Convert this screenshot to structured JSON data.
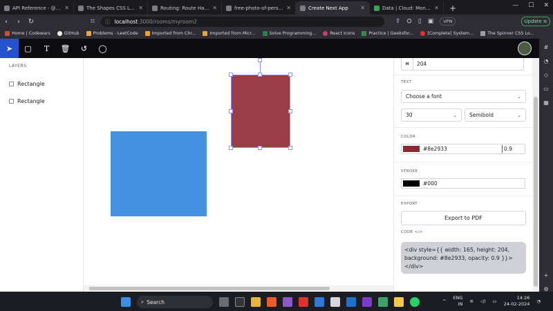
{
  "browser": {
    "tabs": [
      {
        "label": "API Reference - @liveblocks/re",
        "active": false
      },
      {
        "label": "The Shapes CSS Loaders Collec",
        "active": false
      },
      {
        "label": "Routing: Route Handlers | Next",
        "active": false
      },
      {
        "label": "free-photo-of-person-in-frenc",
        "active": false
      },
      {
        "label": "Create Next App",
        "active": true
      },
      {
        "label": "Data | Cloud: MongoDB Cloud",
        "active": false
      }
    ],
    "new_tab": "+",
    "url_host": "localhost",
    "url_path": ":3000/rooms/myroom2",
    "vpn_label": "VPN",
    "update_label": "Update",
    "bookmarks": [
      "Home | Codewars",
      "GitHub",
      "Problems - LeetCode",
      "Imported from Chr...",
      "Imported from Micr...",
      "Solve Programming...",
      "React Icons",
      "Practice | Geeksfor...",
      "[Complete] System...",
      "The Spinner CSS Lo..."
    ]
  },
  "toolbar": {
    "tools": [
      "select-tool",
      "rectangle-tool",
      "text-tool",
      "delete-tool",
      "undo-tool",
      "comment-tool"
    ],
    "active_tool": "select-tool"
  },
  "layers": {
    "title": "LAYERS",
    "items": [
      "Rectangle",
      "Rectangle"
    ]
  },
  "canvas": {
    "shapes": [
      {
        "type": "rectangle",
        "color": "#8e2933",
        "opacity": 0.9,
        "selected": true
      },
      {
        "type": "rectangle",
        "color": "#4393e0",
        "selected": false
      }
    ]
  },
  "properties": {
    "height_label": "H",
    "height_value": "204",
    "text_section": "TEXT",
    "font_family_placeholder": "Choose a font",
    "font_size": "30",
    "font_weight": "Semibold",
    "color_section": "COLOR",
    "fill_color": "#8e2933",
    "fill_opacity": "0.9",
    "stroke_section": "STROKE",
    "stroke_color": "#000",
    "export_section": "EXPORT",
    "export_button": "Export to PDF",
    "code_section": "CODE </>",
    "code_snippet": "<div style={{ width: 165, height: 204, background: #8e2933, opacity: 0.9 }}> </div>"
  },
  "taskbar": {
    "search_label": "Search",
    "language_line1": "ENG",
    "language_line2": "IN",
    "time": "14:26",
    "date": "24-02-2024"
  }
}
